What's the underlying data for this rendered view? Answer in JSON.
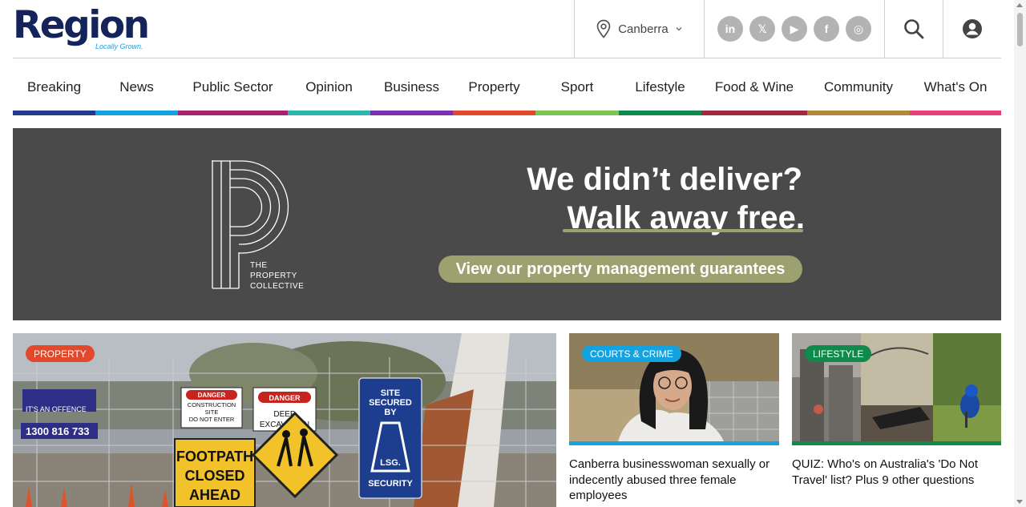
{
  "brand": {
    "name": "Region",
    "tagline": "Locally Grown."
  },
  "location": {
    "label": "Canberra"
  },
  "social": [
    {
      "name": "linkedin-icon",
      "glyph": "in"
    },
    {
      "name": "x-icon",
      "glyph": "𝕏"
    },
    {
      "name": "youtube-icon",
      "glyph": "▶"
    },
    {
      "name": "facebook-icon",
      "glyph": "f"
    },
    {
      "name": "instagram-icon",
      "glyph": "◎"
    }
  ],
  "nav": {
    "items": [
      {
        "label": "Breaking",
        "color": "#223a8f"
      },
      {
        "label": "News",
        "color": "#13a3e0"
      },
      {
        "label": "Public Sector",
        "color": "#a8236d"
      },
      {
        "label": "Opinion",
        "color": "#2bb7ae"
      },
      {
        "label": "Business",
        "color": "#7b2fb3"
      },
      {
        "label": "Property",
        "color": "#e2482b"
      },
      {
        "label": "Sport",
        "color": "#7dc452"
      },
      {
        "label": "Lifestyle",
        "color": "#0f8a4b"
      },
      {
        "label": "Food & Wine",
        "color": "#a12a3f"
      },
      {
        "label": "Community",
        "color": "#b4873a"
      },
      {
        "label": "What's On",
        "color": "#e63f7c"
      }
    ]
  },
  "banner": {
    "logo_text": [
      "THE",
      "PROPERTY",
      "COLLECTIVE"
    ],
    "headline1": "We didn’t deliver?",
    "headline2": "Walk away free.",
    "cta": "View our property management guarantees"
  },
  "stories": {
    "main": {
      "badge": "PROPERTY",
      "badge_color": "#e2482b",
      "signs": {
        "danger1": "DANGER",
        "construction": "CONSTRUCTION",
        "site": "SITE",
        "donotenter": "DO NOT ENTER",
        "danger2": "DANGER",
        "deep": "DEEP",
        "excavation": "EXCAVATION",
        "footpath": "FOOTPATH",
        "closed": "CLOSED",
        "ahead": "AHEAD",
        "secured1": "SITE",
        "secured2": "SECURED",
        "secured3": "BY",
        "lsg": "LSG.",
        "security": "SECURITY",
        "phone": "1300 816 733",
        "offence": "IT'S AN OFFENCE"
      }
    },
    "second": {
      "badge": "COURTS & CRIME",
      "badge_color": "#13a3e0",
      "title": "Canberra businesswoman sexually or indecently abused three female employees"
    },
    "third": {
      "badge": "LIFESTYLE",
      "badge_color": "#0f8a4b",
      "title": "QUIZ: Who's on Australia's 'Do Not Travel' list? Plus 9 other questions"
    }
  }
}
